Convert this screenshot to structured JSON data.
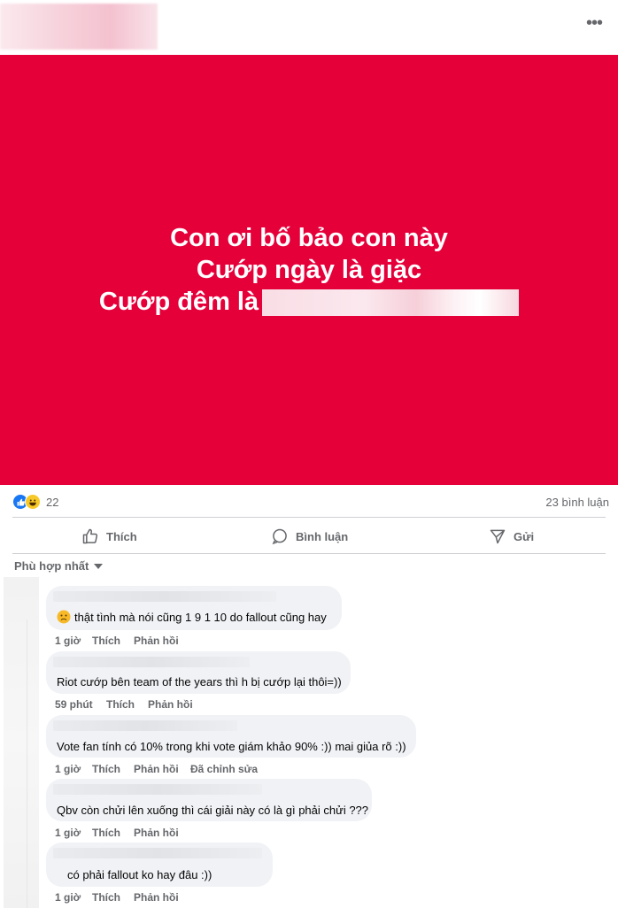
{
  "post": {
    "more_icon": "more-horizontal-icon",
    "banner_color": "#e5003a",
    "banner_lines": [
      "Con ơi bố bảo con này",
      "Cướp ngày là giặc",
      "Cướp đêm là"
    ]
  },
  "stats": {
    "reaction_count": "22",
    "reaction_icons": [
      "like-icon",
      "haha-icon"
    ],
    "comment_count": "23 bình luận"
  },
  "actions": {
    "like": "Thích",
    "comment": "Bình luận",
    "share": "Gửi"
  },
  "sort": {
    "label": "Phù hợp nhất"
  },
  "comments": [
    {
      "text": "thật tình mà nói cũng 1 9 1 10 do fallout cũng hay",
      "time": "1 giờ",
      "like": "Thích",
      "reply": "Phản hồi",
      "has_emoji": true
    },
    {
      "text": "Riot cướp bên team of the years thì h bị cướp lại thôi=))",
      "time": "59 phút",
      "like": "Thích",
      "reply": "Phản hồi"
    },
    {
      "text": "Vote fan tính có 10% trong khi vote giám khảo 90% :)) mai giủa rõ :))",
      "time": "1 giờ",
      "like": "Thích",
      "reply": "Phản hồi",
      "edited": "Đã chỉnh sửa"
    },
    {
      "text": "Qbv còn chửi lên xuống thì cái giải này có là gì phải chửi ???",
      "time": "1 giờ",
      "like": "Thích",
      "reply": "Phản hồi"
    },
    {
      "text": "có phải fallout ko hay đâu :))",
      "time": "1 giờ",
      "like": "Thích",
      "reply": "Phản hồi"
    }
  ]
}
